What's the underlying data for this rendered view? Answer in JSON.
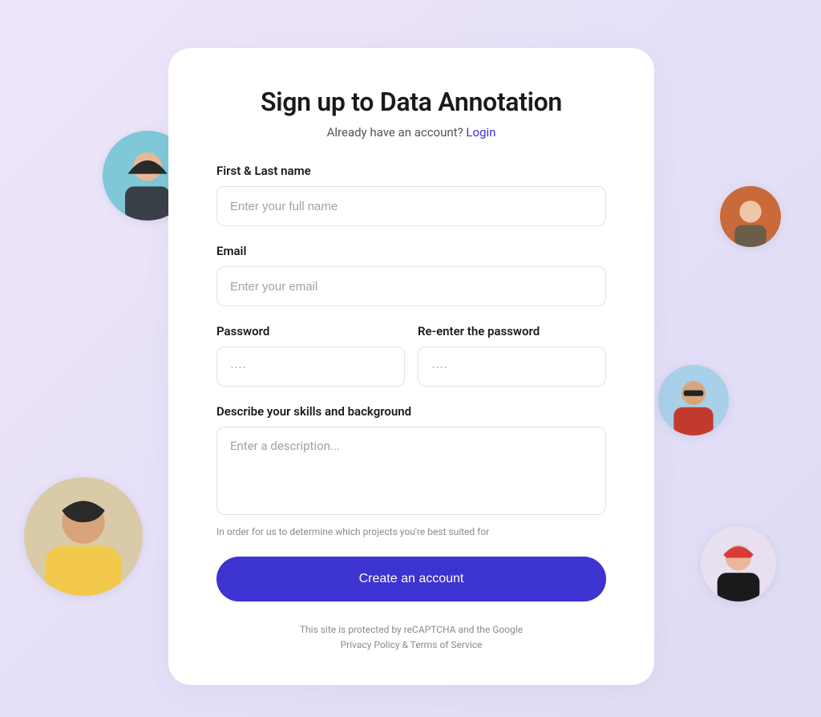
{
  "header": {
    "title": "Sign up to Data Annotation",
    "subtitle_prefix": "Already have an account? ",
    "login_link": "Login"
  },
  "form": {
    "name": {
      "label": "First & Last name",
      "placeholder": "Enter your full name"
    },
    "email": {
      "label": "Email",
      "placeholder": "Enter your email"
    },
    "password": {
      "label": "Password",
      "placeholder": "····"
    },
    "password_confirm": {
      "label": "Re-enter the password",
      "placeholder": "····"
    },
    "description": {
      "label": "Describe your skills and background",
      "placeholder": "Enter a description...",
      "helper": "In order for us to determine which projects you're best suited for"
    },
    "submit_label": "Create an account"
  },
  "footer": {
    "line1": "This site is protected by reCAPTCHA and the Google",
    "privacy": "Privacy Policy",
    "separator": " & ",
    "terms": "Terms of Service"
  }
}
